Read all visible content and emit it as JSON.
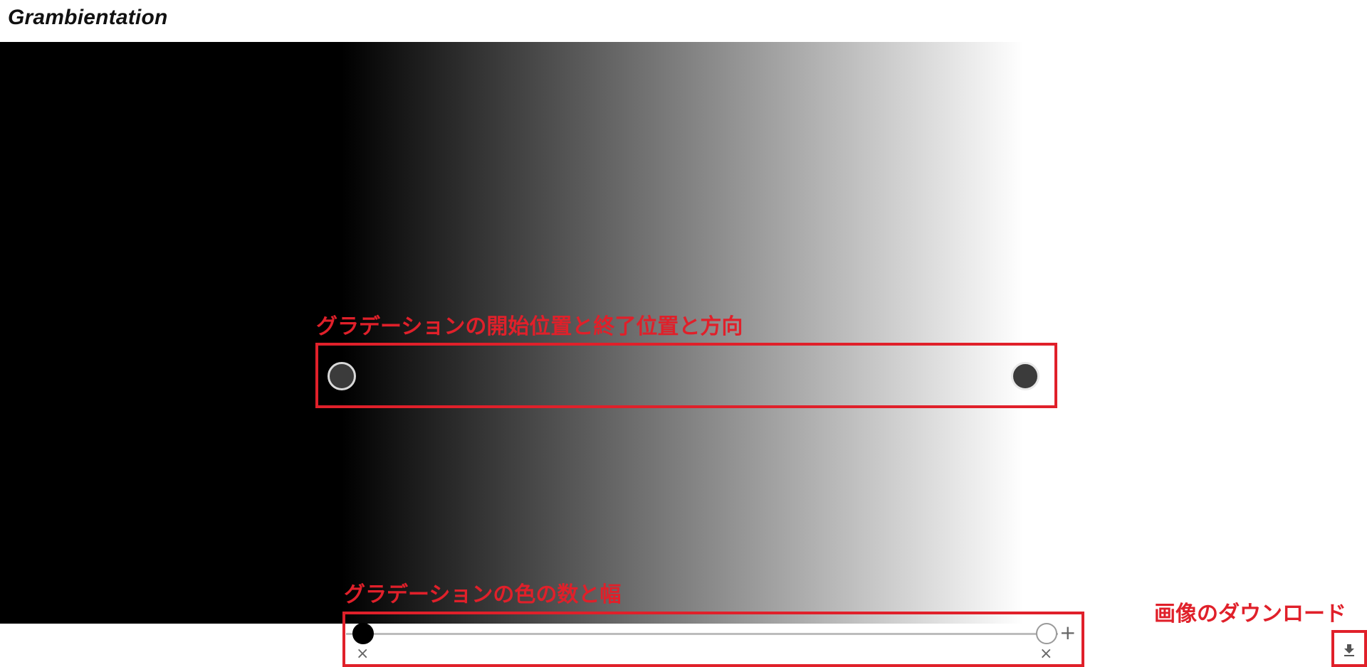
{
  "app": {
    "title": "Grambientation"
  },
  "gradient": {
    "start_color": "#000000",
    "end_color": "#ffffff"
  },
  "annotations": {
    "direction": "グラデーションの開始位置と終了位置と方向",
    "stops": "グラデーションの色の数と幅",
    "download": "画像のダウンロード"
  },
  "icons": {
    "add_stop": "+",
    "remove_stop": "×",
    "download": "download-icon"
  },
  "colors": {
    "accent": "#e0202a",
    "handle_fill": "#3b3b3b"
  }
}
